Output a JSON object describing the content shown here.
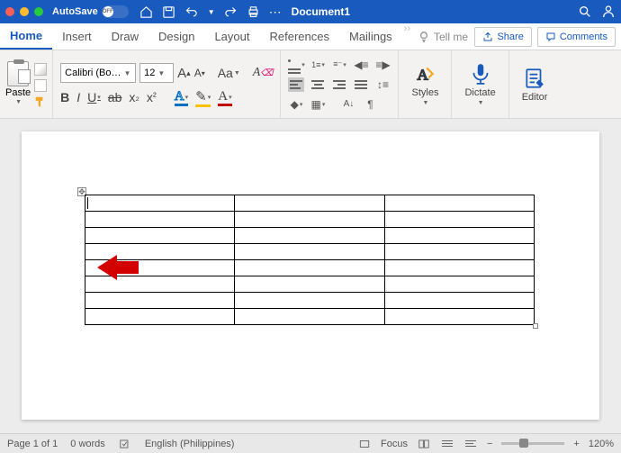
{
  "titlebar": {
    "autosave_label": "AutoSave",
    "autosave_state": "OFF",
    "doc_title": "Document1"
  },
  "tabs": {
    "items": [
      "Home",
      "Insert",
      "Draw",
      "Design",
      "Layout",
      "References",
      "Mailings"
    ],
    "active": "Home",
    "tellme": "Tell me",
    "share": "Share",
    "comments": "Comments"
  },
  "ribbon": {
    "paste": "Paste",
    "font_name": "Calibri (Bo…",
    "font_size": "12",
    "aa_label": "Aa",
    "styles": "Styles",
    "dictate": "Dictate",
    "editor": "Editor"
  },
  "table": {
    "rows": 8,
    "cols": 3
  },
  "statusbar": {
    "page": "Page 1 of 1",
    "words": "0 words",
    "language": "English (Philippines)",
    "focus": "Focus",
    "zoom": "120%"
  },
  "colors": {
    "accent": "#185ABD"
  }
}
